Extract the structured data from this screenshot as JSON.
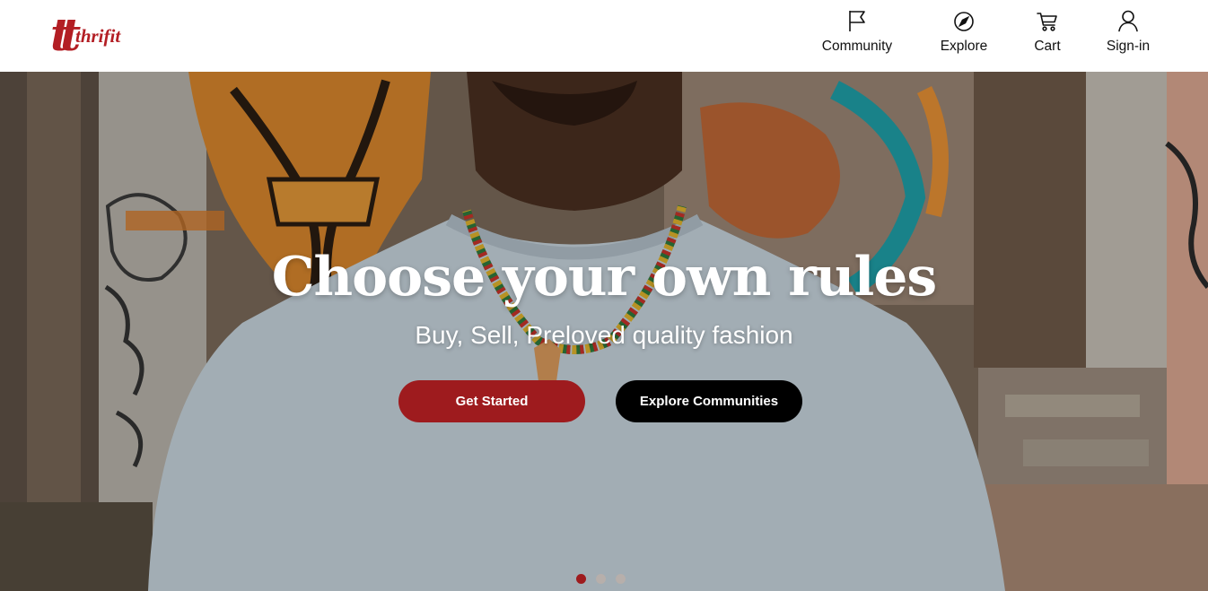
{
  "brand": {
    "logo_mark": "tt",
    "logo_word": "thrifit",
    "color": "#b31e24"
  },
  "nav": {
    "community": {
      "label": "Community",
      "icon": "flag-icon"
    },
    "explore": {
      "label": "Explore",
      "icon": "compass-icon"
    },
    "cart": {
      "label": "Cart",
      "icon": "cart-icon"
    },
    "signin": {
      "label": "Sign-in",
      "icon": "user-icon"
    }
  },
  "hero": {
    "image": "man-with-beaded-necklace-in-front-of-graffiti-wall",
    "title": "Choose your own rules",
    "subtitle": "Buy, Sell, Preloved quality fashion",
    "primary_button": "Get Started",
    "secondary_button": "Explore Communities",
    "primary_color": "#9e1b1e",
    "carousel": {
      "slide_count": 3,
      "active_slide": 1
    }
  }
}
